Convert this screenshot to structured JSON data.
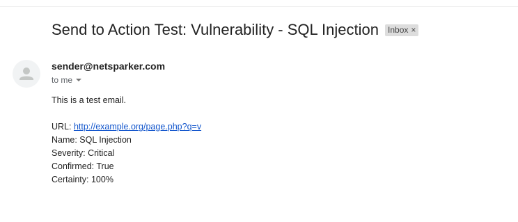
{
  "email": {
    "subject": "Send to Action Test: Vulnerability - SQL Injection",
    "label": "Inbox",
    "label_close": "×",
    "sender": "sender@netsparker.com",
    "recipient": "to me",
    "body": {
      "intro": "This is a test email.",
      "url_label": "URL: ",
      "url_link": "http://example.org/page.php?q=v",
      "name": "Name: SQL Injection",
      "severity": "Severity: Critical",
      "confirmed": "Confirmed: True",
      "certainty": "Certainty: 100%"
    }
  },
  "icons": {
    "avatar": "person-icon",
    "recipient_caret": "chevron-down-icon",
    "label_close": "close-icon"
  },
  "colors": {
    "link": "#1155cc",
    "chip_background": "#dddddd",
    "avatar_background": "#f1f3f4"
  }
}
